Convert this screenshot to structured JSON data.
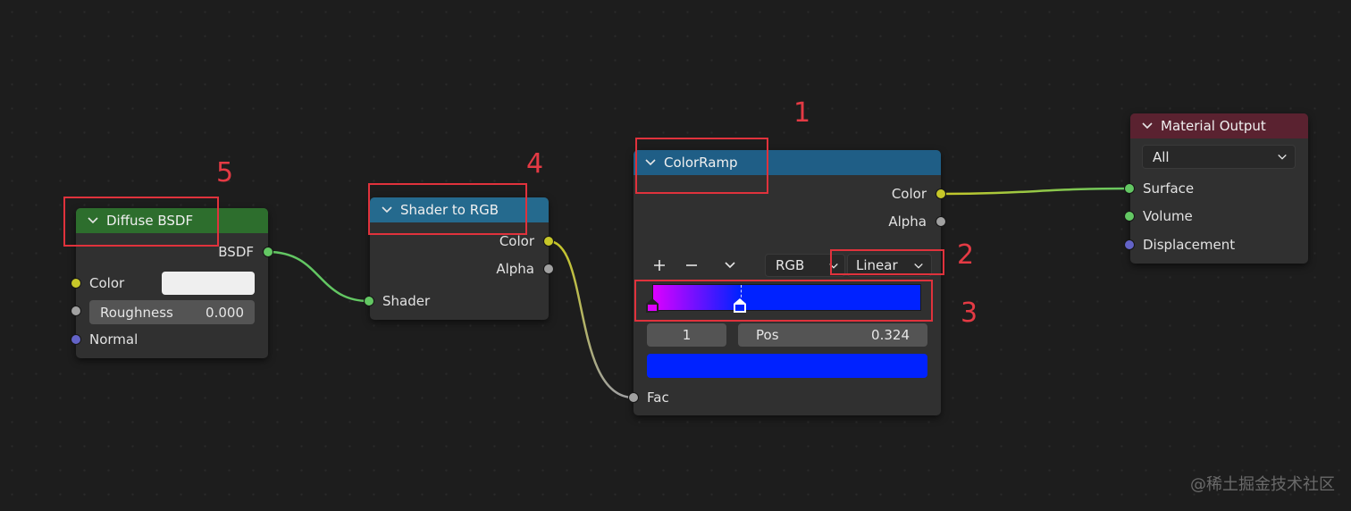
{
  "colors": {
    "background": "#1d1d1d",
    "node_body": "#303030",
    "header_shader": "#1f5e86",
    "header_converter": "#256a8e",
    "header_output": "#5a2230",
    "header_diffuse": "#2d6e2d",
    "socket_shader": "#63c763",
    "socket_color": "#c7c729",
    "socket_float": "#a1a1a1",
    "socket_vector": "#6363c7",
    "annotation_red": "#e0323c",
    "ramp_stop_a": "#dd00ff",
    "ramp_stop_b": "#0022ff"
  },
  "diffuse": {
    "title": "Diffuse BSDF",
    "output_bsdf": "BSDF",
    "input_color": "Color",
    "input_roughness_label": "Roughness",
    "input_roughness_value": "0.000",
    "input_normal": "Normal"
  },
  "shader_to_rgb": {
    "title": "Shader to RGB",
    "output_color": "Color",
    "output_alpha": "Alpha",
    "input_shader": "Shader"
  },
  "color_ramp": {
    "title": "ColorRamp",
    "output_color": "Color",
    "output_alpha": "Alpha",
    "add_icon": "plus-icon",
    "remove_icon": "minus-icon",
    "menu_icon": "chevron-down-icon",
    "color_mode": "RGB",
    "interpolation": "Linear",
    "active_index": "1",
    "pos_label": "Pos",
    "pos_value": "0.324",
    "input_fac": "Fac",
    "stops": [
      {
        "position": 0.0,
        "color": "#dd00ff"
      },
      {
        "position": 0.324,
        "color": "#0022ff"
      }
    ]
  },
  "material_output": {
    "title": "Material Output",
    "target": "All",
    "input_surface": "Surface",
    "input_volume": "Volume",
    "input_displacement": "Displacement"
  },
  "annotations": [
    "1",
    "2",
    "3",
    "4",
    "5"
  ],
  "watermark": "@稀土掘金技术社区"
}
